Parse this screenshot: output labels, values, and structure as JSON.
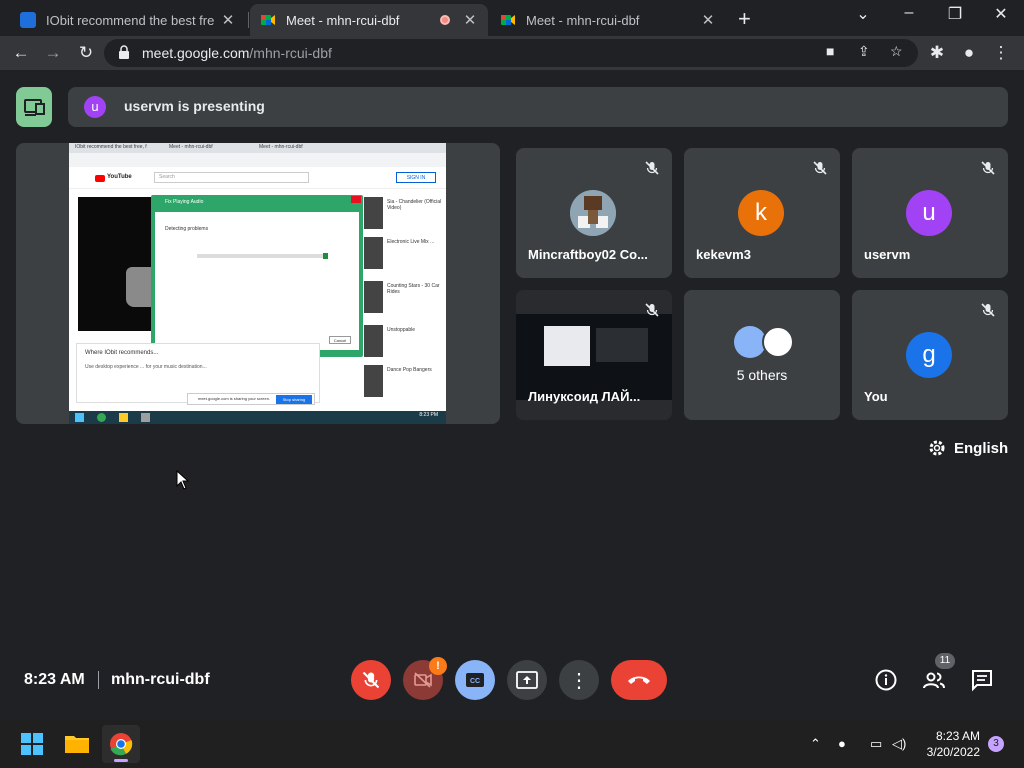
{
  "browser": {
    "tabs": [
      {
        "title": "IObit recommend the best free, f",
        "active": false
      },
      {
        "title": "Meet - mhn-rcui-dbf",
        "active": true,
        "recording": true
      },
      {
        "title": "Meet - mhn-rcui-dbf",
        "active": false
      }
    ],
    "url_domain": "meet.google.com",
    "url_path": "/mhn-rcui-dbf"
  },
  "meet": {
    "presenting_initial": "u",
    "presenting_text": "uservm is presenting",
    "shared_screen": {
      "youtube_label": "YouTube",
      "search_placeholder": "Search",
      "signin_label": "SIGN IN",
      "dialog_title": "Fix Playing Audio",
      "dialog_message": "Detecting problems",
      "cancel_label": "Cancel",
      "progress": 0.97,
      "rec_title": "Where IObit recommends...",
      "rec_text": "Use desktop experience ... for your music destination...",
      "share_text": "meet.google.com is sharing your screen.",
      "stop_label": "Stop sharing",
      "side_videos": [
        "Sia - Chandelier (Official Video)",
        "Electronic Live Mix ...",
        "Counting Stars - 30 Car Rides",
        "Unstoppable",
        "Dance Pop Bangers"
      ],
      "clock": "8:23 PM"
    },
    "participants": [
      {
        "name": "Mincraftboy02 Co...",
        "muted": true,
        "type": "image"
      },
      {
        "name": "kekevm3",
        "initial": "k",
        "color": "#e8710a",
        "muted": true
      },
      {
        "name": "uservm",
        "initial": "u",
        "color": "#a142f4",
        "muted": true
      },
      {
        "name": "Линуксоид ЛАЙ...",
        "muted": true,
        "type": "video"
      },
      {
        "others_text": "5 others"
      },
      {
        "name": "You",
        "initial": "g",
        "color": "#1a73e8",
        "muted": true
      }
    ],
    "caption_language": "English",
    "time": "8:23 AM",
    "meeting_code": "mhn-rcui-dbf",
    "camera_alert_badge": "!",
    "participant_count": "11"
  },
  "windows": {
    "time": "8:23 AM",
    "date": "3/20/2022",
    "notification_count": "3"
  }
}
